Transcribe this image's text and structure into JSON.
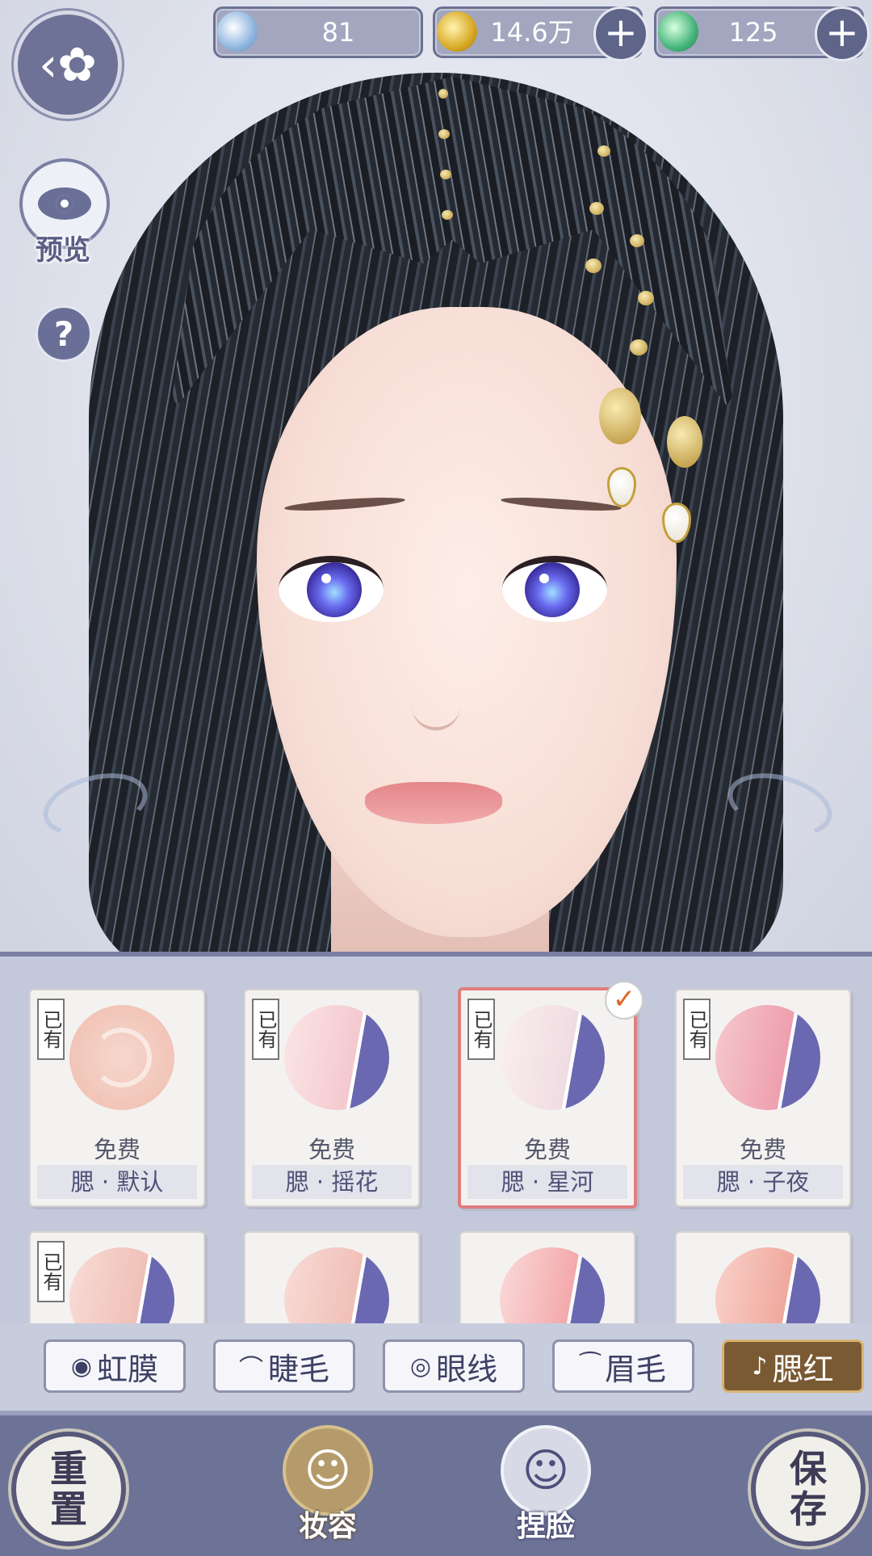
{
  "currencies": [
    {
      "icon": "jade-token-icon",
      "value": "81",
      "has_plus": false
    },
    {
      "icon": "copper-coin-icon",
      "value": "14.6万",
      "has_plus": true
    },
    {
      "icon": "green-dragon-coin-icon",
      "value": "125",
      "has_plus": true
    }
  ],
  "hud": {
    "back_icon": "butterfly-back-icon",
    "preview_label": "预览",
    "help_label": "?"
  },
  "blush_items": [
    {
      "owned": "已有",
      "price": "免费",
      "name": "腮 · 默认",
      "selected": false
    },
    {
      "owned": "已有",
      "price": "免费",
      "name": "腮 · 摇花",
      "selected": false
    },
    {
      "owned": "已有",
      "price": "免费",
      "name": "腮 · 星河",
      "selected": true
    },
    {
      "owned": "已有",
      "price": "免费",
      "name": "腮 · 子夜",
      "selected": false
    },
    {
      "owned": "已有",
      "price": "",
      "name": "",
      "selected": false
    },
    {
      "owned": "",
      "price": "",
      "name": "",
      "selected": false
    },
    {
      "owned": "",
      "price": "",
      "name": "",
      "selected": false
    },
    {
      "owned": "",
      "price": "",
      "name": "",
      "selected": false
    }
  ],
  "tabs": [
    {
      "label": "虹膜",
      "icon": "iris-icon",
      "active": false
    },
    {
      "label": "睫毛",
      "icon": "eyelash-icon",
      "active": false
    },
    {
      "label": "眼线",
      "icon": "eyeliner-icon",
      "active": false
    },
    {
      "label": "眉毛",
      "icon": "eyebrow-icon",
      "active": false
    },
    {
      "label": "腮红",
      "icon": "blush-icon",
      "active": true
    }
  ],
  "bottom": {
    "reset": {
      "line1": "重",
      "line2": "置"
    },
    "makeup_label": "妆容",
    "face_label": "捏脸",
    "save": {
      "line1": "保",
      "line2": "存"
    }
  },
  "colors": {
    "accent_purple": "#6d7297",
    "selected_border": "#e07d7f",
    "active_tab": "#7a5a33"
  }
}
